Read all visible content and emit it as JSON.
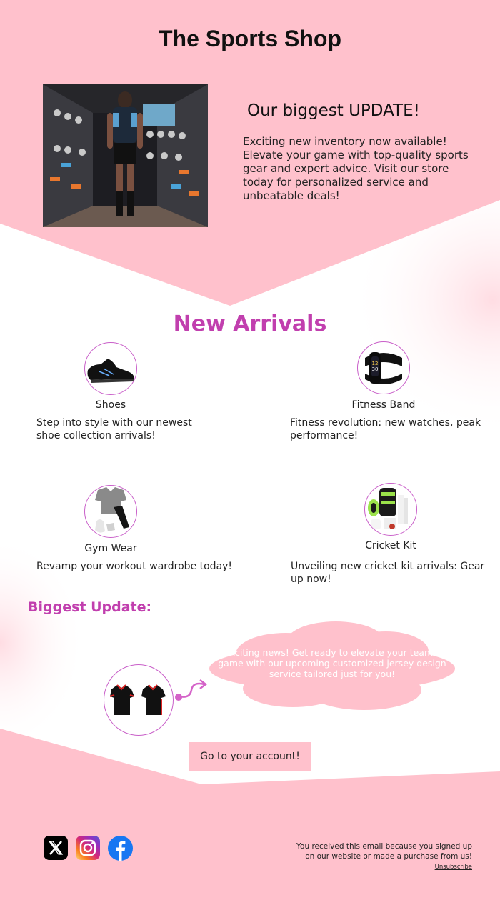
{
  "colors": {
    "pink": "#ffc1cc",
    "accent": "#c13fae",
    "circle_border": "#c95fc9"
  },
  "header": {
    "title": "The Sports Shop"
  },
  "hero": {
    "image_icon": "sports-store-photo-icon",
    "heading": "Our biggest UPDATE!",
    "text": "Exciting new inventory now available! Elevate your game with top-quality sports gear and expert advice. Visit our store today for personalized service and unbeatable deals!"
  },
  "new_arrivals": {
    "title": "New Arrivals",
    "items": [
      {
        "name": "Shoes",
        "desc": "Step into style with our newest shoe collection arrivals!",
        "icon": "shoes-icon"
      },
      {
        "name": "Fitness Band",
        "desc": "Fitness revolution: new watches, peak performance!",
        "icon": "fitness-band-icon"
      },
      {
        "name": "Gym Wear",
        "desc": "Revamp your workout wardrobe today!",
        "icon": "gym-wear-icon"
      },
      {
        "name": "Cricket Kit",
        "desc": "Unveiling new cricket kit arrivals: Gear up now!",
        "icon": "cricket-kit-icon"
      }
    ]
  },
  "biggest_update": {
    "title": "Biggest Update:",
    "message": "Exciting news! Get ready to elevate your team's game with our upcoming customized jersey design service tailored just for you!",
    "image_icon": "jersey-icon"
  },
  "cta": {
    "label": "Go to your account!"
  },
  "footer": {
    "socials": [
      "x-icon",
      "instagram-icon",
      "facebook-icon"
    ],
    "notice": "You received this email because you signed up on our website or made a purchase from us!",
    "unsubscribe": "Unsubscribe"
  }
}
